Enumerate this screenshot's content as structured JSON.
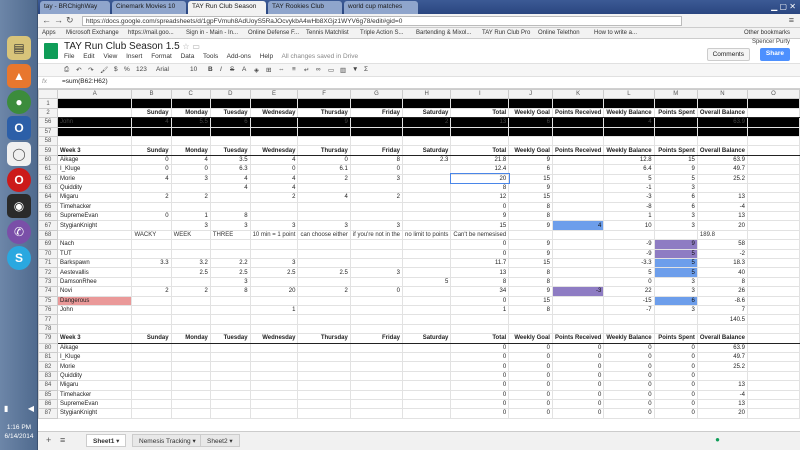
{
  "taskbar": {
    "time": "1:16 PM",
    "date": "6/14/2014"
  },
  "browser": {
    "tabs": [
      {
        "label": "tay - BRChighWay",
        "active": false
      },
      {
        "label": "Cinemark Movies 10",
        "active": false
      },
      {
        "label": "TAY Run Club Season",
        "active": true
      },
      {
        "label": "TAY Rookies Club",
        "active": false
      },
      {
        "label": "world cup matches",
        "active": false
      }
    ],
    "url": "https://docs.google.com/spreadsheets/d/1gpFVmuh8AdUoyS5RaJOcvykbA4wHb8XGjz1WYV6g78/edit#gid=0",
    "bookmarks": [
      "Apps",
      "Microsoft Exchange",
      "https://mail.goo...",
      "Sign in - Main - In...",
      "Online Defense F...",
      "Tennis Matchlist",
      "Triple Action S...",
      "Bartending & Mixol...",
      "TAY Run Club Pro",
      "Online Telethon",
      "How to write a...",
      "Other bookmarks"
    ]
  },
  "doc": {
    "title": "TAY Run Club Season 1.5",
    "menus": [
      "File",
      "Edit",
      "View",
      "Insert",
      "Format",
      "Data",
      "Tools",
      "Add-ons",
      "Help"
    ],
    "save_status": "All changes saved in Drive",
    "user": "Spencer Purty",
    "comments_label": "Comments",
    "share_label": "Share",
    "font_name": "Arial",
    "font_size": "10",
    "zoom_format": "123",
    "formula_ref": "fx",
    "formula_text": "=sum(B62:H62)"
  },
  "columns": [
    "A",
    "B",
    "C",
    "D",
    "E",
    "F",
    "G",
    "H",
    "I",
    "J",
    "K",
    "L",
    "M",
    "N",
    "O"
  ],
  "rows": [
    {
      "n": "1",
      "type": "black",
      "cells": [
        "",
        "",
        "",
        "",
        "",
        "",
        "",
        "",
        "",
        "",
        "",
        "",
        "",
        "",
        ""
      ]
    },
    {
      "n": "2",
      "type": "hdr",
      "cells": [
        "",
        "Sunday",
        "Monday",
        "Tuesday",
        "Wednesday",
        "Thursday",
        "Friday",
        "Saturday",
        "Total",
        "Weekly Goal",
        "Points Received",
        "Weekly Balance",
        "Points Spent",
        "Overall Balance",
        ""
      ]
    },
    {
      "n": "56",
      "type": "black",
      "cells": [
        "John",
        "4",
        "5.5",
        "6",
        "",
        "9",
        "",
        "2",
        "13",
        "6",
        "",
        "4",
        "",
        "63.9",
        ""
      ]
    },
    {
      "n": "57",
      "type": "black",
      "cells": [
        "",
        "",
        "",
        "",
        "",
        "",
        "",
        "",
        "",
        "",
        "",
        "",
        "",
        "",
        ""
      ]
    },
    {
      "n": "58",
      "type": "blank",
      "cells": [
        "",
        "",
        "",
        "",
        "",
        "",
        "",
        "",
        "",
        "",
        "",
        "",
        "",
        "",
        ""
      ]
    },
    {
      "n": "59",
      "type": "hdr",
      "cells": [
        "Week 3",
        "Sunday",
        "Monday",
        "Tuesday",
        "Wednesday",
        "Thursday",
        "Friday",
        "Saturday",
        "Total",
        "Weekly Goal",
        "Points Received",
        "Weekly Balance",
        "Points Spent",
        "Overall Balance",
        ""
      ]
    },
    {
      "n": "60",
      "type": "data",
      "cells": [
        "Aikage",
        "0",
        "4",
        "3.5",
        "4",
        "0",
        "8",
        "2.3",
        "21.8",
        "9",
        "",
        "12.8",
        "15",
        "63.9",
        ""
      ]
    },
    {
      "n": "61",
      "type": "data",
      "cells": [
        "I_Kluge",
        "0",
        "0",
        "6.3",
        "0",
        "6.1",
        "0",
        "",
        "12.4",
        "6",
        "",
        "6.4",
        "9",
        "49.7",
        ""
      ]
    },
    {
      "n": "62",
      "type": "data",
      "cells": [
        "Morie",
        "4",
        "3",
        "4",
        "4",
        "2",
        "3",
        "",
        "20",
        "15",
        "",
        "5",
        "5",
        "25.2",
        ""
      ]
    },
    {
      "n": "63",
      "type": "data",
      "cells": [
        "Quiddity",
        "",
        "",
        "4",
        "4",
        "",
        "",
        "",
        "8",
        "9",
        "",
        "-1",
        "3",
        "",
        ""
      ]
    },
    {
      "n": "64",
      "type": "data",
      "cells": [
        "Migaru",
        "2",
        "2",
        "",
        "2",
        "4",
        "2",
        "",
        "12",
        "15",
        "",
        "-3",
        "6",
        "13",
        ""
      ]
    },
    {
      "n": "65",
      "type": "data",
      "cells": [
        "Timehacker",
        "",
        "",
        "",
        "",
        "",
        "",
        "",
        "0",
        "8",
        "",
        "-8",
        "6",
        "-4",
        ""
      ]
    },
    {
      "n": "66",
      "type": "data",
      "cells": [
        "SupremeEvan",
        "0",
        "1",
        "8",
        "",
        "",
        "",
        "",
        "9",
        "8",
        "",
        "1",
        "3",
        "13",
        ""
      ]
    },
    {
      "n": "67",
      "type": "data",
      "cells": [
        "StygianKnight",
        "",
        "3",
        "3",
        "3",
        "3",
        "3",
        "",
        "15",
        "9",
        "4",
        "10",
        "3",
        "20",
        ""
      ]
    },
    {
      "n": "68",
      "type": "note",
      "cells": [
        "",
        "WACKY",
        "WEEK",
        "THREE",
        "10 min = 1 point",
        "can choose either",
        "if you're not in the",
        "no limit to points",
        "Can't be nemesised",
        "",
        "",
        "",
        "",
        "189.8",
        ""
      ]
    },
    {
      "n": "69",
      "type": "data",
      "cells": [
        "Nach",
        "",
        "",
        "",
        "",
        "",
        "",
        "",
        "0",
        "9",
        "",
        "-9",
        "9",
        "58",
        ""
      ]
    },
    {
      "n": "70",
      "type": "data",
      "cells": [
        "TUT",
        "",
        "",
        "",
        "",
        "",
        "",
        "",
        "0",
        "9",
        "",
        "-9",
        "5",
        "-2",
        ""
      ]
    },
    {
      "n": "71",
      "type": "data",
      "cells": [
        "Barkspawn",
        "3.3",
        "3.2",
        "2.2",
        "3",
        "",
        "",
        "",
        "11.7",
        "15",
        "",
        "-3.3",
        "5",
        "18.3",
        ""
      ]
    },
    {
      "n": "72",
      "type": "data",
      "cells": [
        "Aestevallis",
        "",
        "2.5",
        "2.5",
        "2.5",
        "2.5",
        "3",
        "",
        "13",
        "8",
        "",
        "5",
        "5",
        "40",
        ""
      ]
    },
    {
      "n": "73",
      "type": "data",
      "cells": [
        "DamsonRhee",
        "",
        "",
        "3",
        "",
        "",
        "",
        "5",
        "8",
        "8",
        "",
        "0",
        "3",
        "8",
        ""
      ]
    },
    {
      "n": "74",
      "type": "data",
      "cells": [
        "Novi",
        "2",
        "2",
        "8",
        "20",
        "2",
        "0",
        "",
        "34",
        "9",
        "-3",
        "22",
        "3",
        "26",
        ""
      ]
    },
    {
      "n": "75",
      "type": "data",
      "cells": [
        "Dangerous",
        "",
        "",
        "",
        "",
        "",
        "",
        "",
        "0",
        "15",
        "",
        "-15",
        "6",
        "-8.6",
        ""
      ]
    },
    {
      "n": "76",
      "type": "data",
      "cells": [
        "John",
        "",
        "",
        "",
        "1",
        "",
        "",
        "",
        "1",
        "8",
        "",
        "-7",
        "3",
        "7",
        ""
      ]
    },
    {
      "n": "77",
      "type": "data",
      "cells": [
        "",
        "",
        "",
        "",
        "",
        "",
        "",
        "",
        "",
        "",
        "",
        "",
        "",
        "140.5",
        ""
      ]
    },
    {
      "n": "78",
      "type": "blank",
      "cells": [
        "",
        "",
        "",
        "",
        "",
        "",
        "",
        "",
        "",
        "",
        "",
        "",
        "",
        "",
        ""
      ]
    },
    {
      "n": "79",
      "type": "hdr",
      "cells": [
        "Week 3",
        "Sunday",
        "Monday",
        "Tuesday",
        "Wednesday",
        "Thursday",
        "Friday",
        "Saturday",
        "Total",
        "Weekly Goal",
        "Points Received",
        "Weekly Balance",
        "Points Spent",
        "Overall Balance",
        ""
      ]
    },
    {
      "n": "80",
      "type": "data",
      "cells": [
        "Aikage",
        "",
        "",
        "",
        "",
        "",
        "",
        "",
        "0",
        "0",
        "0",
        "0",
        "0",
        "63.9",
        ""
      ]
    },
    {
      "n": "81",
      "type": "data",
      "cells": [
        "I_Kluge",
        "",
        "",
        "",
        "",
        "",
        "",
        "",
        "0",
        "0",
        "0",
        "0",
        "0",
        "49.7",
        ""
      ]
    },
    {
      "n": "82",
      "type": "data",
      "cells": [
        "Morie",
        "",
        "",
        "",
        "",
        "",
        "",
        "",
        "0",
        "0",
        "0",
        "0",
        "0",
        "25.2",
        ""
      ]
    },
    {
      "n": "83",
      "type": "data",
      "cells": [
        "Quiddity",
        "",
        "",
        "",
        "",
        "",
        "",
        "",
        "0",
        "0",
        "0",
        "0",
        "0",
        "",
        ""
      ]
    },
    {
      "n": "84",
      "type": "data",
      "cells": [
        "Migaru",
        "",
        "",
        "",
        "",
        "",
        "",
        "",
        "0",
        "0",
        "0",
        "0",
        "0",
        "13",
        ""
      ]
    },
    {
      "n": "85",
      "type": "data",
      "cells": [
        "Timehacker",
        "",
        "",
        "",
        "",
        "",
        "",
        "",
        "0",
        "0",
        "0",
        "0",
        "0",
        "-4",
        ""
      ]
    },
    {
      "n": "86",
      "type": "data",
      "cells": [
        "SupremeEvan",
        "",
        "",
        "",
        "",
        "",
        "",
        "",
        "0",
        "0",
        "0",
        "0",
        "0",
        "13",
        ""
      ]
    },
    {
      "n": "87",
      "type": "data",
      "cells": [
        "StygianKnight",
        "",
        "",
        "",
        "",
        "",
        "",
        "",
        "0",
        "0",
        "0",
        "0",
        "0",
        "20",
        ""
      ]
    }
  ],
  "highlights": [
    {
      "row": "67",
      "col": 10,
      "color": "blue"
    },
    {
      "row": "74",
      "col": 10,
      "color": "purple"
    },
    {
      "row": "69",
      "col": 12,
      "color": "purple"
    },
    {
      "row": "70",
      "col": 12,
      "color": "purple"
    },
    {
      "row": "71",
      "col": 12,
      "color": "blue"
    },
    {
      "row": "72",
      "col": 12,
      "color": "blue"
    },
    {
      "row": "75",
      "col": 12,
      "color": "blue"
    },
    {
      "row": "75",
      "col": 0,
      "color": "pink"
    }
  ],
  "sheet_tabs": [
    {
      "label": "Sheet1",
      "active": true
    },
    {
      "label": "Nemesis Tracking",
      "active": false
    },
    {
      "label": "Sheet2",
      "active": false
    }
  ]
}
